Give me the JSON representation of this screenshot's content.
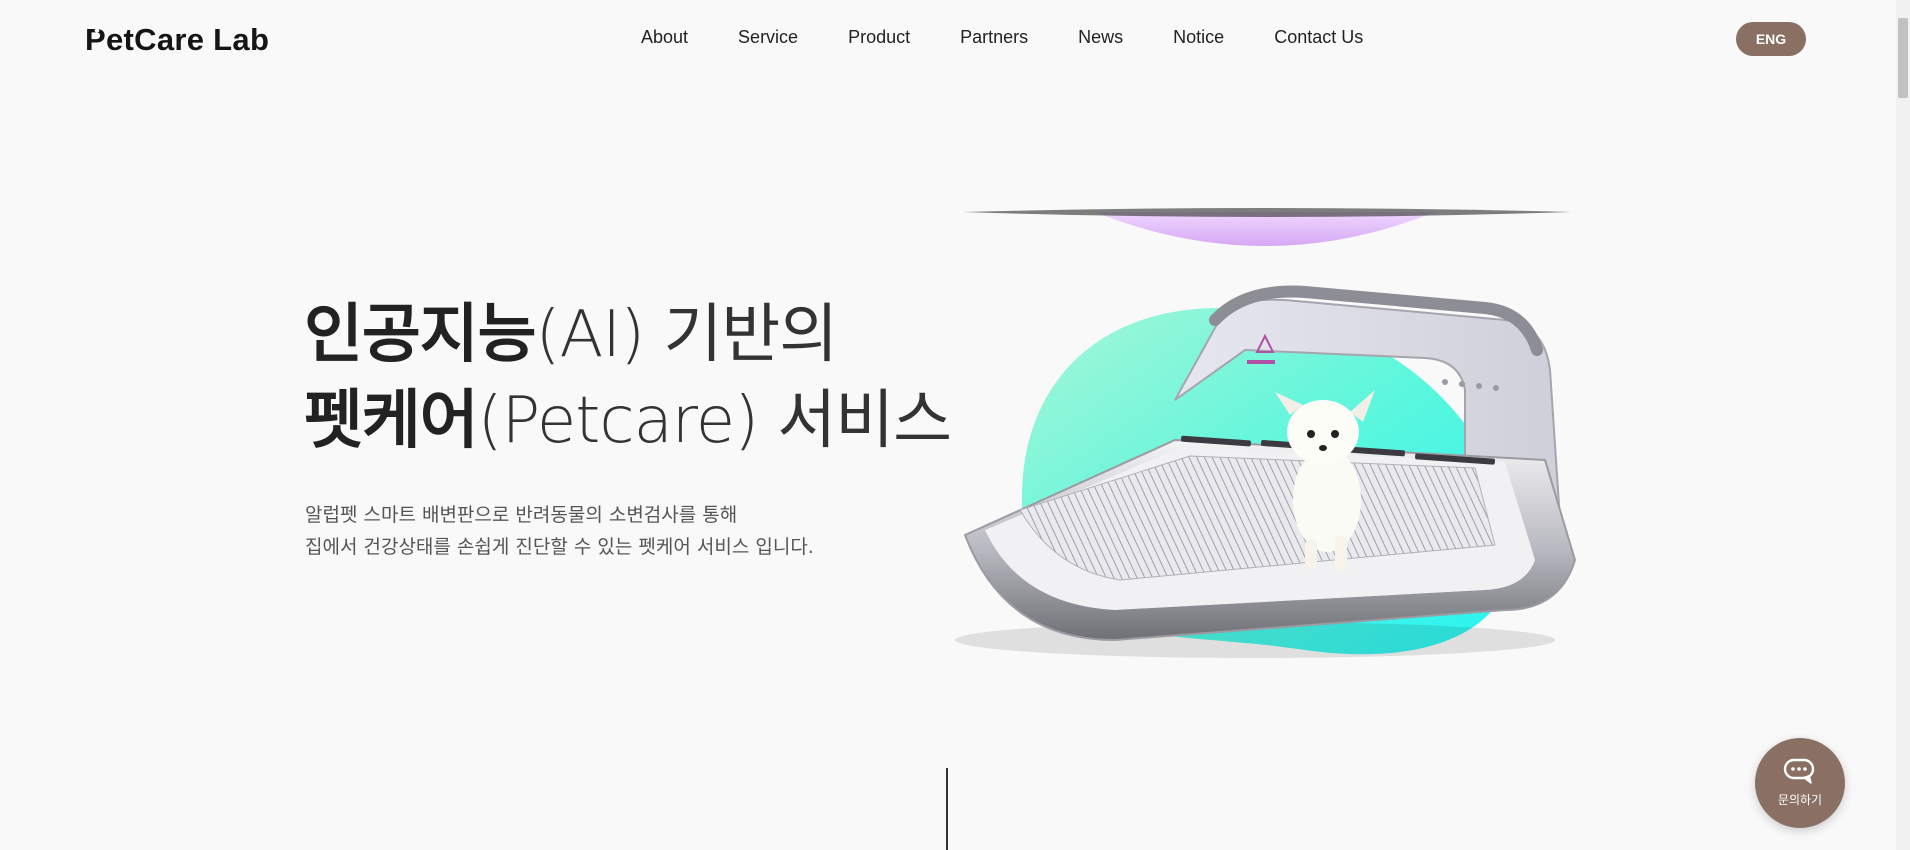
{
  "header": {
    "logo_text": "PetCare Lab",
    "nav": [
      {
        "label": "About"
      },
      {
        "label": "Service"
      },
      {
        "label": "Product"
      },
      {
        "label": "Partners"
      },
      {
        "label": "News"
      },
      {
        "label": "Notice"
      },
      {
        "label": "Contact Us"
      }
    ],
    "lang_button": "ENG"
  },
  "hero": {
    "line1_bold": "인공지능",
    "line1_light": "(AI) 기반의",
    "line2_bold": "펫케어",
    "line2_light": "(Petcare) 서비스",
    "sub_line1": "알럽펫 스마트 배변판으로 반려동물의 소변검사를 통해",
    "sub_line2": "집에서 건강상태를 손쉽게 진단할 수 있는 펫케어 서비스 입니다."
  },
  "chat": {
    "label": "문의하기",
    "icon": "chat-bubble-icon"
  },
  "icons": {
    "logo_paw": "paw-icon",
    "chat": "chat-bubble-icon"
  },
  "colors": {
    "background": "#f9f9f9",
    "accent_brown": "#8a6f63",
    "mint": "#3ef3e8",
    "lavender": "#dcb8f6"
  }
}
